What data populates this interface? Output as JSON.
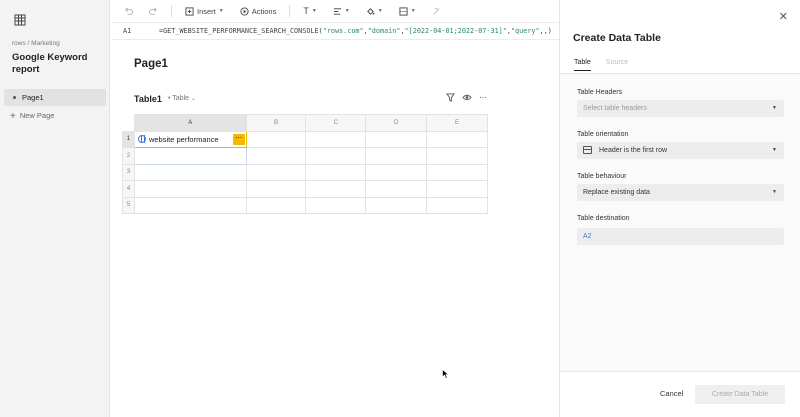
{
  "sidebar": {
    "breadcrumb": "rows / Marketing",
    "doc_title": "Google Keyword report",
    "pages": [
      {
        "label": "Page1"
      }
    ],
    "new_page_label": "New Page"
  },
  "toolbar": {
    "insert_label": "Insert",
    "actions_label": "Actions"
  },
  "formula_bar": {
    "cell_ref": "A1",
    "fn": "=GET_WEBSITE_PERFORMANCE_SEARCH_CONSOLE(",
    "arg1": "\"rows.com\"",
    "arg2": "\"domain\"",
    "arg3": "\"[2022-04-01;2022-07-31]\"",
    "arg4": "\"query\"",
    "tail": ",,)"
  },
  "page": {
    "title": "Page1",
    "table_title": "Table1",
    "table_type": "Table"
  },
  "grid": {
    "columns": [
      "A",
      "B",
      "C",
      "D",
      "E"
    ],
    "rows": [
      "1",
      "2",
      "3",
      "4",
      "5"
    ],
    "a1_value": "website performance"
  },
  "panel": {
    "title": "Create Data Table",
    "tabs": [
      "Table",
      "Source"
    ],
    "headers_label": "Table Headers",
    "headers_placeholder": "Select table headers",
    "orientation_label": "Table orientation",
    "orientation_value": "Header is the first row",
    "behaviour_label": "Table behaviour",
    "behaviour_value": "Replace existing data",
    "destination_label": "Table destination",
    "destination_value": "A2",
    "cancel_label": "Cancel",
    "create_label": "Create Data Table"
  },
  "colors": {
    "selection": "#f0b400",
    "link": "#3b7bd6",
    "formula_string": "#2a8a6e"
  }
}
